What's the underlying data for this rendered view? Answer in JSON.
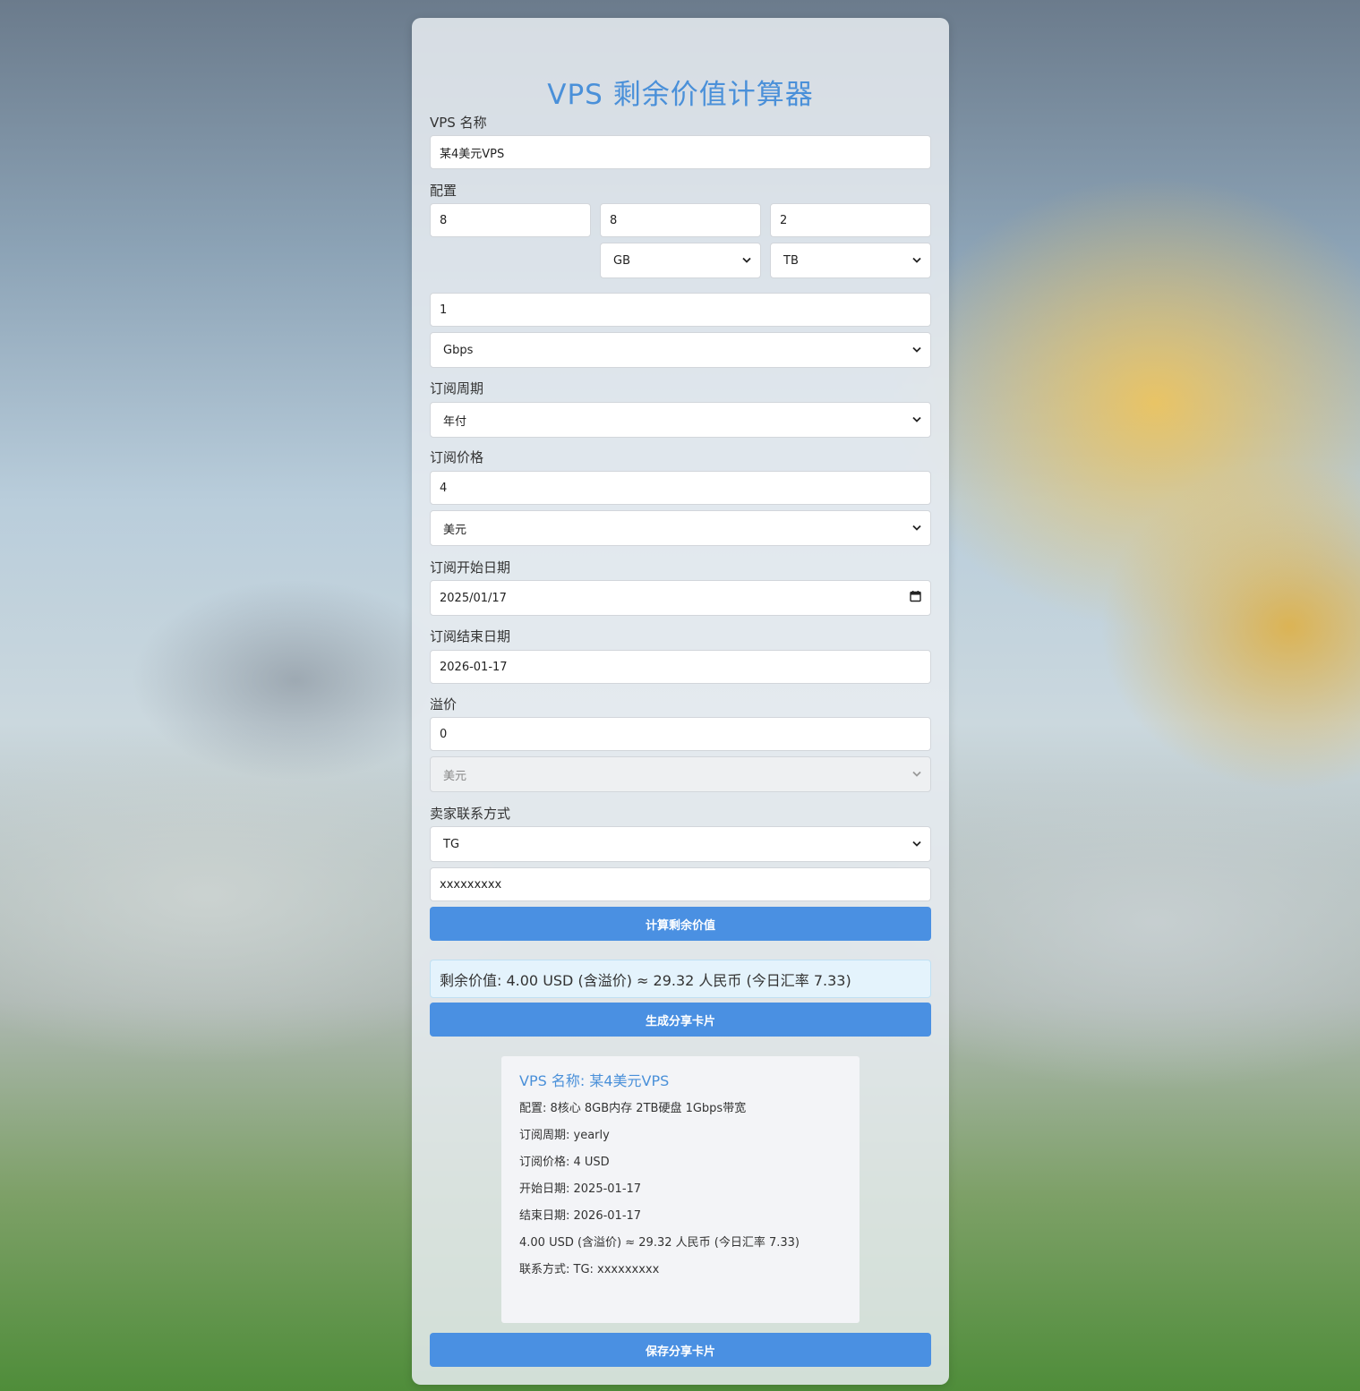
{
  "app_title": "VPS 剩余价值计算器",
  "form": {
    "name_label": "VPS 名称",
    "name_value": "某4美元VPS",
    "config_label": "配置",
    "cpu_value": "8",
    "ram_value": "8",
    "disk_value": "2",
    "ram_unit": "GB",
    "disk_unit": "TB",
    "bandwidth_value": "1",
    "bandwidth_unit": "Gbps",
    "cycle_label": "订阅周期",
    "cycle_value": "年付",
    "price_label": "订阅价格",
    "price_value": "4",
    "price_currency": "美元",
    "start_label": "订阅开始日期",
    "start_value": "2025/01/17",
    "end_label": "订阅结束日期",
    "end_value": "2026-01-17",
    "premium_label": "溢价",
    "premium_value": "0",
    "premium_currency": "美元",
    "contact_label": "卖家联系方式",
    "contact_type": "TG",
    "contact_value": "xxxxxxxxx"
  },
  "buttons": {
    "calculate": "计算剩余价值",
    "generate_card": "生成分享卡片",
    "save_card": "保存分享卡片"
  },
  "result_text": "剩余价值: 4.00 USD (含溢价) ≈ 29.32 人民币 (今日汇率 7.33)",
  "share_card": {
    "name": "VPS 名称: 某4美元VPS",
    "config": "配置: 8核心 8GB内存 2TB硬盘 1Gbps带宽",
    "cycle": "订阅周期: yearly",
    "price": "订阅价格: 4 USD",
    "start": "开始日期: 2025-01-17",
    "end": "结束日期: 2026-01-17",
    "value": "4.00 USD (含溢价) ≈ 29.32 人民币 (今日汇率 7.33)",
    "contact": "联系方式: TG: xxxxxxxxx"
  },
  "colors": {
    "accent": "#4a90e2",
    "title": "#4a90d9",
    "result_bg": "#e4f3fc"
  }
}
